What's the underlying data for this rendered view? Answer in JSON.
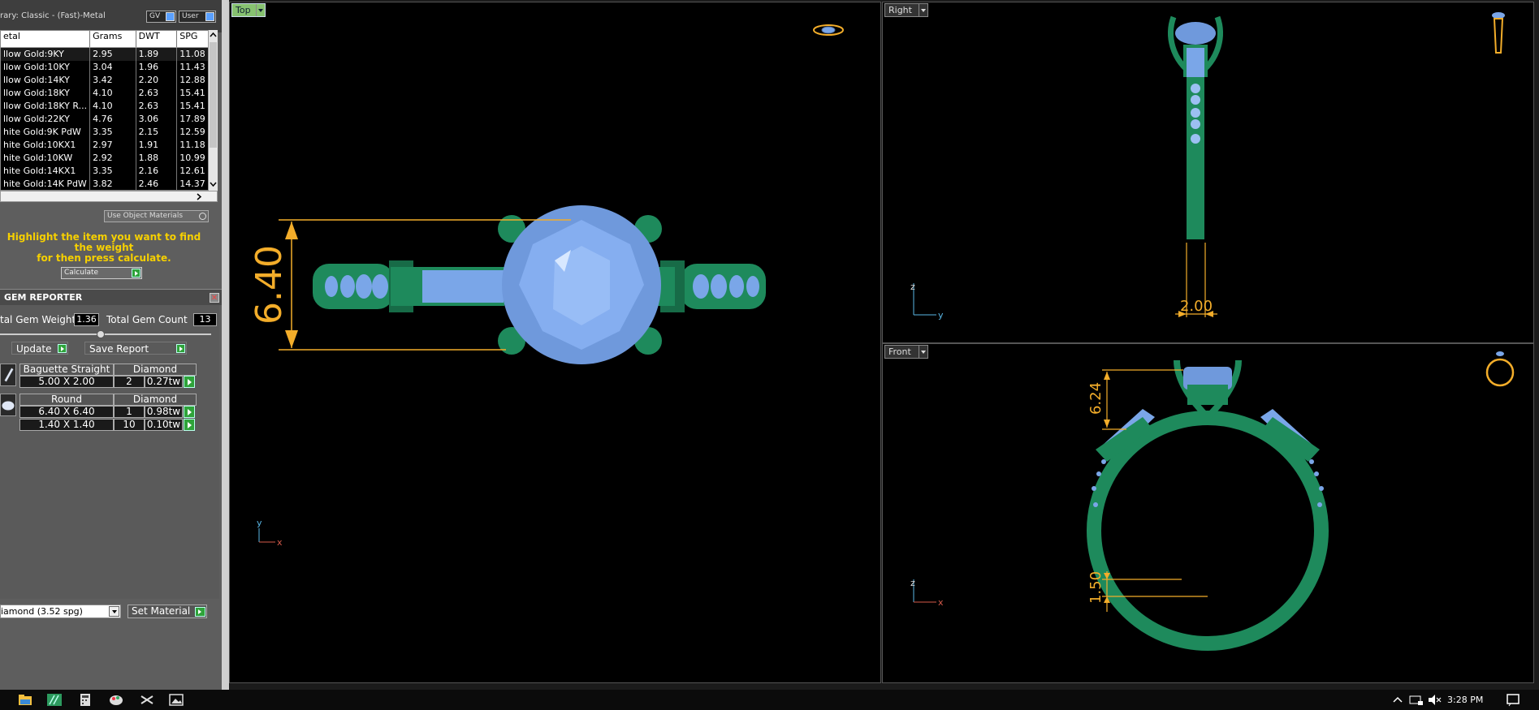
{
  "library": {
    "title": "rary: Classic - (Fast)-Metal",
    "toggle_gv": "GV",
    "toggle_user": "User"
  },
  "metal_table": {
    "headers": [
      "etal",
      "Grams",
      "DWT",
      "SPG"
    ],
    "rows": [
      {
        "name": "llow Gold:9KY",
        "grams": "2.95",
        "dwt": "1.89",
        "spg": "11.08"
      },
      {
        "name": "llow Gold:10KY",
        "grams": "3.04",
        "dwt": "1.96",
        "spg": "11.43"
      },
      {
        "name": "llow Gold:14KY",
        "grams": "3.42",
        "dwt": "2.20",
        "spg": "12.88"
      },
      {
        "name": "llow Gold:18KY",
        "grams": "4.10",
        "dwt": "2.63",
        "spg": "15.41"
      },
      {
        "name": "llow Gold:18KY R...",
        "grams": "4.10",
        "dwt": "2.63",
        "spg": "15.41"
      },
      {
        "name": "llow Gold:22KY",
        "grams": "4.76",
        "dwt": "3.06",
        "spg": "17.89"
      },
      {
        "name": "hite Gold:9K PdW",
        "grams": "3.35",
        "dwt": "2.15",
        "spg": "12.59"
      },
      {
        "name": "hite Gold:10KX1",
        "grams": "2.97",
        "dwt": "1.91",
        "spg": "11.18"
      },
      {
        "name": "hite Gold:10KW",
        "grams": "2.92",
        "dwt": "1.88",
        "spg": "10.99"
      },
      {
        "name": "hite Gold:14KX1",
        "grams": "3.35",
        "dwt": "2.16",
        "spg": "12.61"
      },
      {
        "name": "hite Gold:14K PdW",
        "grams": "3.82",
        "dwt": "2.46",
        "spg": "14.37"
      }
    ]
  },
  "use_object_materials": "Use Object Materials",
  "hint": {
    "line1": "Highlight the item you want to find the weight",
    "line2": "for then press calculate."
  },
  "calculate_label": "Calculate",
  "gem_reporter": {
    "title": "GEM REPORTER",
    "close": "✕",
    "total_weight_label": "tal Gem Weight",
    "total_weight": "1.36",
    "total_count_label": "Total Gem Count",
    "total_count": "13",
    "update": "Update",
    "save_report": "Save Report",
    "groups": [
      {
        "shape": "Baguette Straight",
        "material": "Diamond",
        "rows": [
          {
            "size": "5.00 X 2.00",
            "count": "2",
            "weight": "0.27tw"
          }
        ]
      },
      {
        "shape": "Round",
        "material": "Diamond",
        "rows": [
          {
            "size": "6.40 X 6.40",
            "count": "1",
            "weight": "0.98tw"
          },
          {
            "size": "1.40 X 1.40",
            "count": "10",
            "weight": "0.10tw"
          }
        ]
      }
    ]
  },
  "material_select": "iamond    (3.52 spg)",
  "set_material": "Set Material",
  "viewports": {
    "top": {
      "label": "Top",
      "dimension": "6.40",
      "axis_v": "y",
      "axis_h": "x"
    },
    "right": {
      "label": "Right",
      "dimension": "2.00",
      "axis_v": "z",
      "axis_h": "y"
    },
    "front": {
      "label": "Front",
      "dimension_top": "6.24",
      "dimension_bottom": "1.50",
      "axis_v": "z",
      "axis_h": "x"
    }
  },
  "colors": {
    "metal": "#1e8a5c",
    "gem": "#7aa6e8",
    "dimension": "#f3ad2a",
    "active_tab": "#87c270"
  },
  "taskbar": {
    "icons": [
      "file-explorer-icon",
      "matrix-app-icon",
      "calculator-icon",
      "paint-icon",
      "snipping-tool-icon",
      "photos-icon"
    ],
    "tray_icons": [
      "chevron-up-icon",
      "network-icon",
      "volume-mute-icon"
    ],
    "time": "3:28 PM"
  }
}
